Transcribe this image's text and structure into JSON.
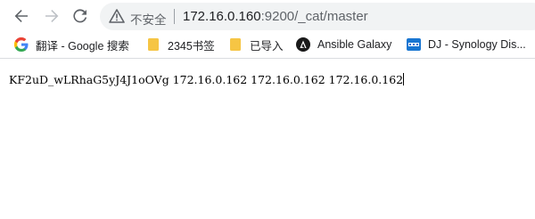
{
  "colors": {
    "toolbar_icon": "#5f6368",
    "omnibox_bg": "#f1f3f4",
    "folder": "#f6c544",
    "google_blue": "#4285f4",
    "synology_blue": "#1976d2",
    "ansible_dark": "#1a1a1a"
  },
  "toolbar": {
    "back_icon": "arrow-left-icon",
    "forward_icon": "arrow-right-icon",
    "reload_icon": "reload-icon"
  },
  "omnibox": {
    "security_icon": "warning-triangle-icon",
    "security_label": "不安全",
    "url_host": "172.16.0.160",
    "url_path": ":9200/_cat/master"
  },
  "bookmarks": [
    {
      "label": "翻译 - Google 搜索",
      "icon": "google-icon"
    },
    {
      "label": "2345书签",
      "icon": "folder-icon"
    },
    {
      "label": "已导入",
      "icon": "folder-icon"
    },
    {
      "label": "Ansible Galaxy",
      "icon": "ansible-icon"
    },
    {
      "label": "DJ - Synology Dis...",
      "icon": "synology-dsm-icon"
    }
  ],
  "page": {
    "response_text": "KF2uD_wLRhaG5yJ4J1oOVg 172.16.0.162 172.16.0.162 172.16.0.162"
  }
}
